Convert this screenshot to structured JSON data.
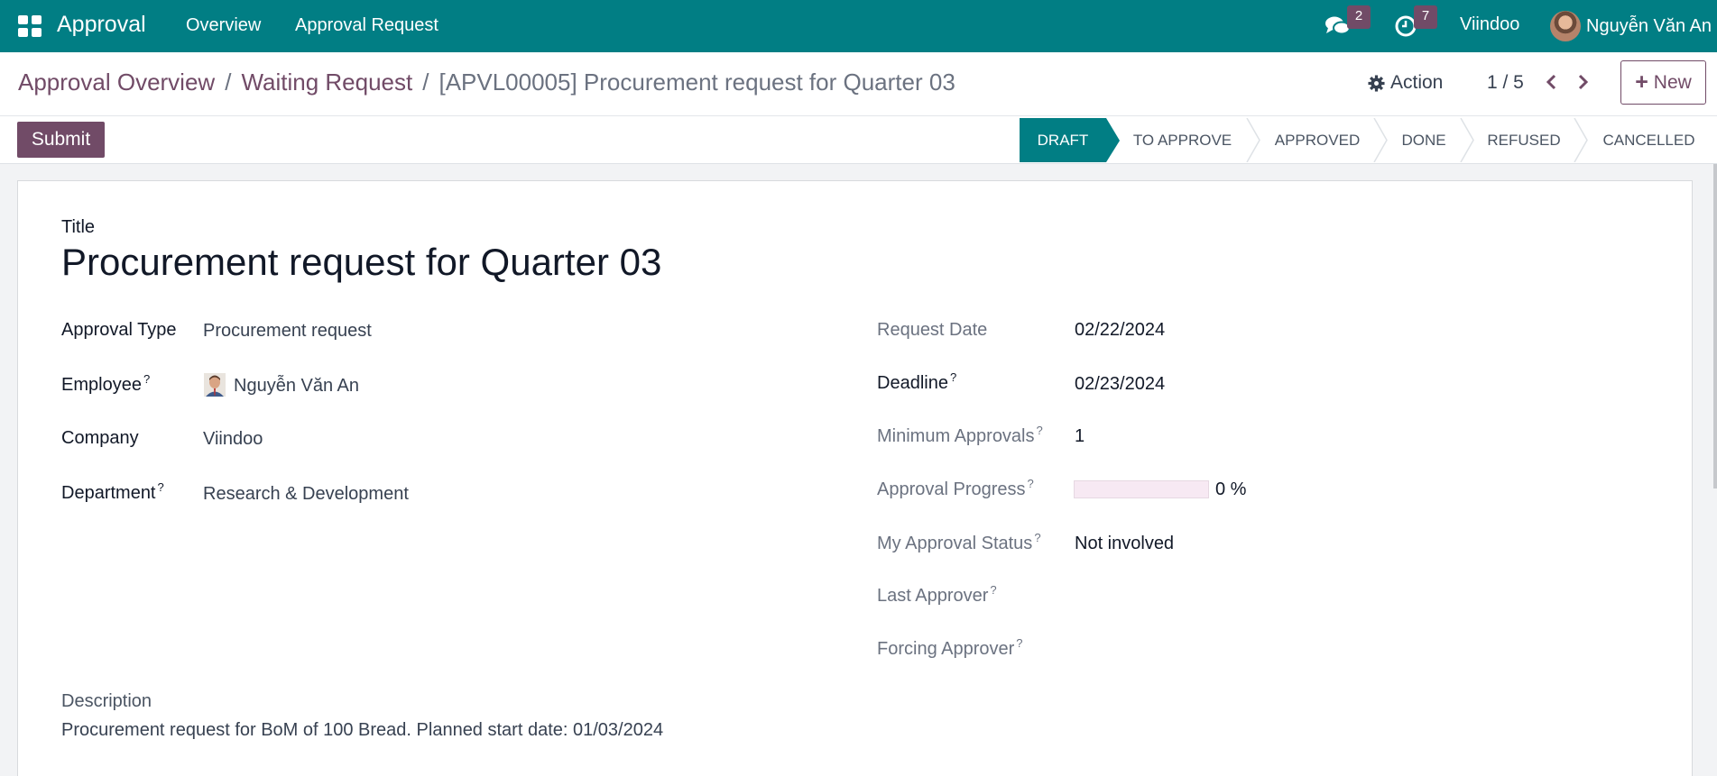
{
  "navbar": {
    "app_name": "Approval",
    "menus": [
      "Overview",
      "Approval Request"
    ],
    "messages_count": "2",
    "activities_count": "7",
    "company": "Viindoo",
    "user": "Nguyễn Văn An"
  },
  "control_panel": {
    "breadcrumbs": [
      "Approval Overview",
      "Waiting Request",
      "[APVL00005] Procurement request for Quarter 03"
    ],
    "action_label": "Action",
    "pager": "1 / 5",
    "new_label": "New"
  },
  "statusbar": {
    "submit_label": "Submit",
    "stages": [
      "DRAFT",
      "TO APPROVE",
      "APPROVED",
      "DONE",
      "REFUSED",
      "CANCELLED"
    ],
    "active_stage": "DRAFT"
  },
  "form": {
    "title_label": "Title",
    "title_value": "Procurement request for Quarter 03",
    "left_fields": [
      {
        "label": "Approval Type",
        "value": "Procurement request",
        "help": false
      },
      {
        "label": "Employee",
        "value": "Nguyễn Văn An",
        "help": true
      },
      {
        "label": "Company",
        "value": "Viindoo",
        "help": false
      },
      {
        "label": "Department",
        "value": "Research & Development",
        "help": true
      }
    ],
    "right_fields": [
      {
        "label": "Request Date",
        "value": "02/22/2024",
        "help": false
      },
      {
        "label": "Deadline",
        "value": "02/23/2024",
        "help": true
      },
      {
        "label": "Minimum Approvals",
        "value": "1",
        "help": true
      },
      {
        "label": "Approval Progress",
        "value": "0 %",
        "help": true,
        "progress_fraction": 0
      },
      {
        "label": "My Approval Status",
        "value": "Not involved",
        "help": true
      },
      {
        "label": "Last Approver",
        "value": "",
        "help": true
      },
      {
        "label": "Forcing Approver",
        "value": "",
        "help": true
      }
    ],
    "help_mark": "?",
    "description_label": "Description",
    "description_value": "Procurement request for BoM of 100 Bread. Planned start date: 01/03/2024"
  },
  "colors": {
    "navbar": "#017e84",
    "primary": "#714b67",
    "active_stage": "#017e84"
  },
  "icons": [
    "apps-icon",
    "chat-icon",
    "clock-icon",
    "gear-icon",
    "chevron-left-icon",
    "chevron-right-icon",
    "plus-icon"
  ]
}
